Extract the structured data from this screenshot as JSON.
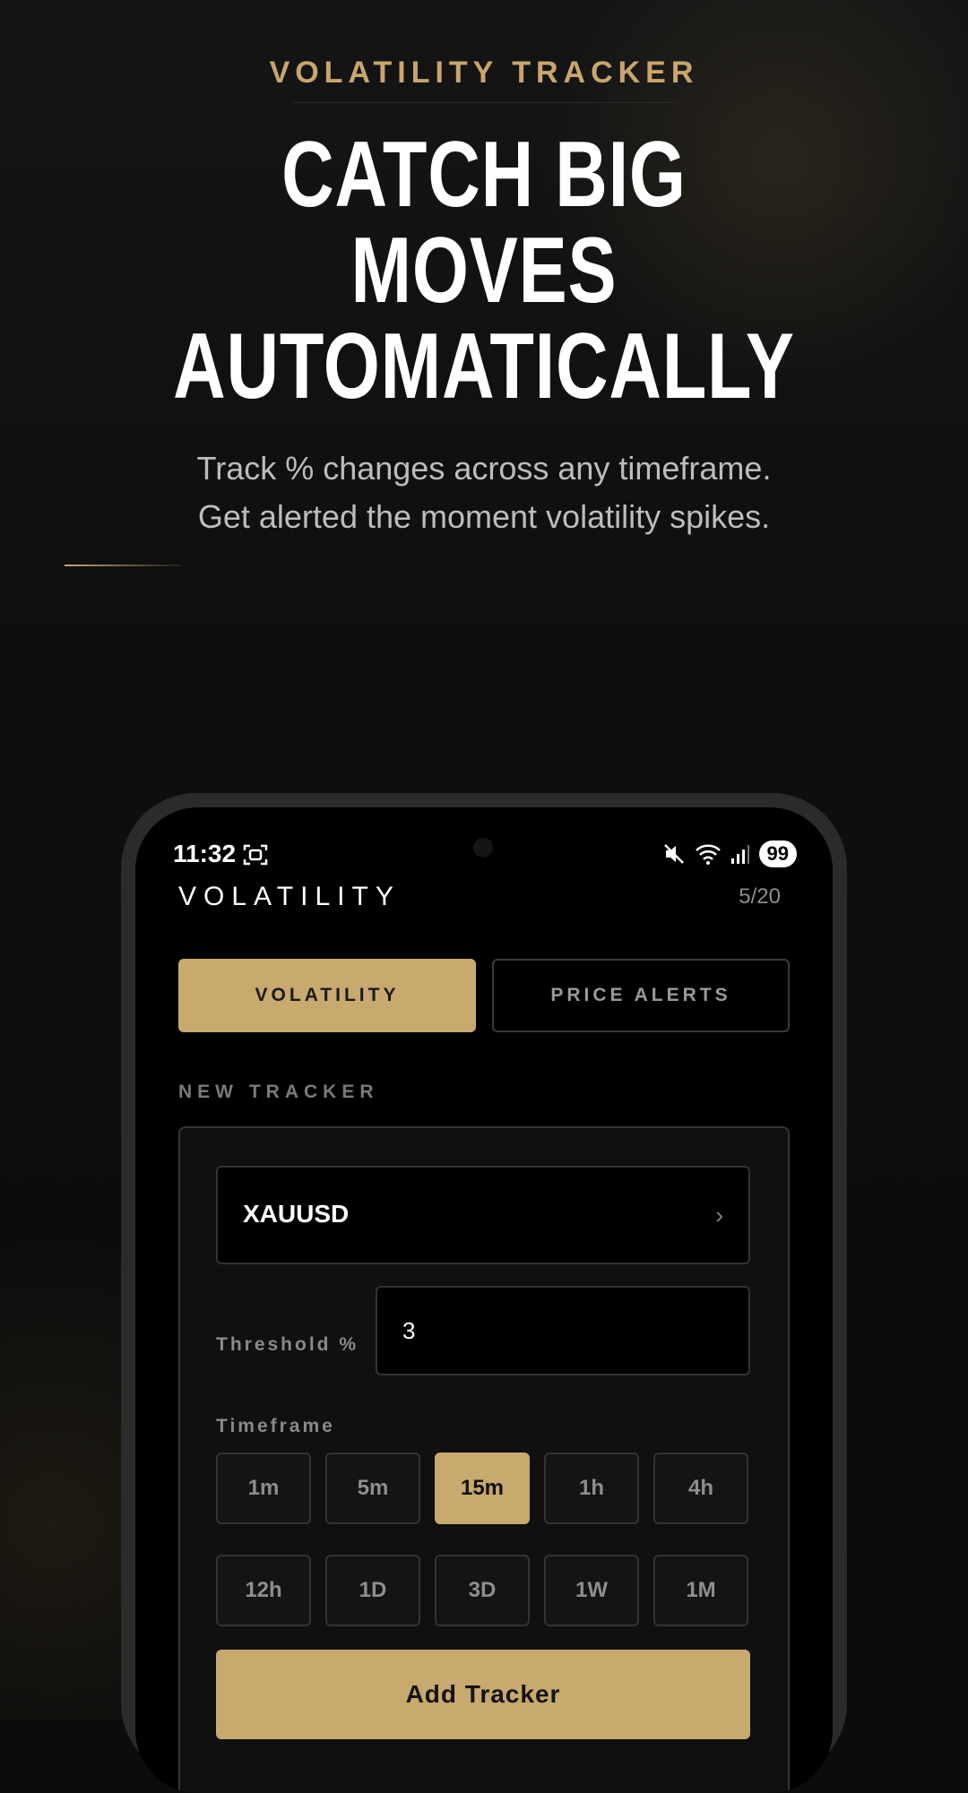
{
  "hero": {
    "eyebrow": "VOLATILITY TRACKER",
    "headline_lines": [
      "CATCH BIG",
      "MOVES",
      "AUTOMATICALLY"
    ],
    "subtitle_lines": [
      "Track % changes across any timeframe.",
      "Get alerted the moment volatility spikes."
    ]
  },
  "status_bar": {
    "time": "11:32",
    "battery": "99",
    "icons": [
      "screenshot-icon",
      "mute-icon",
      "wifi-icon",
      "signal-icon"
    ]
  },
  "app": {
    "title": "VOLATILITY",
    "counter": "5/20",
    "tabs": [
      {
        "label": "VOLATILITY",
        "active": true
      },
      {
        "label": "PRICE ALERTS",
        "active": false
      }
    ],
    "section_label": "NEW TRACKER",
    "symbol": {
      "value": "XAUUSD",
      "icon": "chevron-right-icon",
      "chevron": "›"
    },
    "threshold": {
      "label": "Threshold %",
      "value": "3"
    },
    "timeframe": {
      "label": "Timeframe",
      "options": [
        "1m",
        "5m",
        "15m",
        "1h",
        "4h",
        "12h",
        "1D",
        "3D",
        "1W",
        "1M"
      ],
      "selected": "15m"
    },
    "add_button": "Add Tracker"
  },
  "colors": {
    "accent": "#c8a96e",
    "eyebrow": "#c9a66b",
    "background": "#0c0c0c"
  }
}
